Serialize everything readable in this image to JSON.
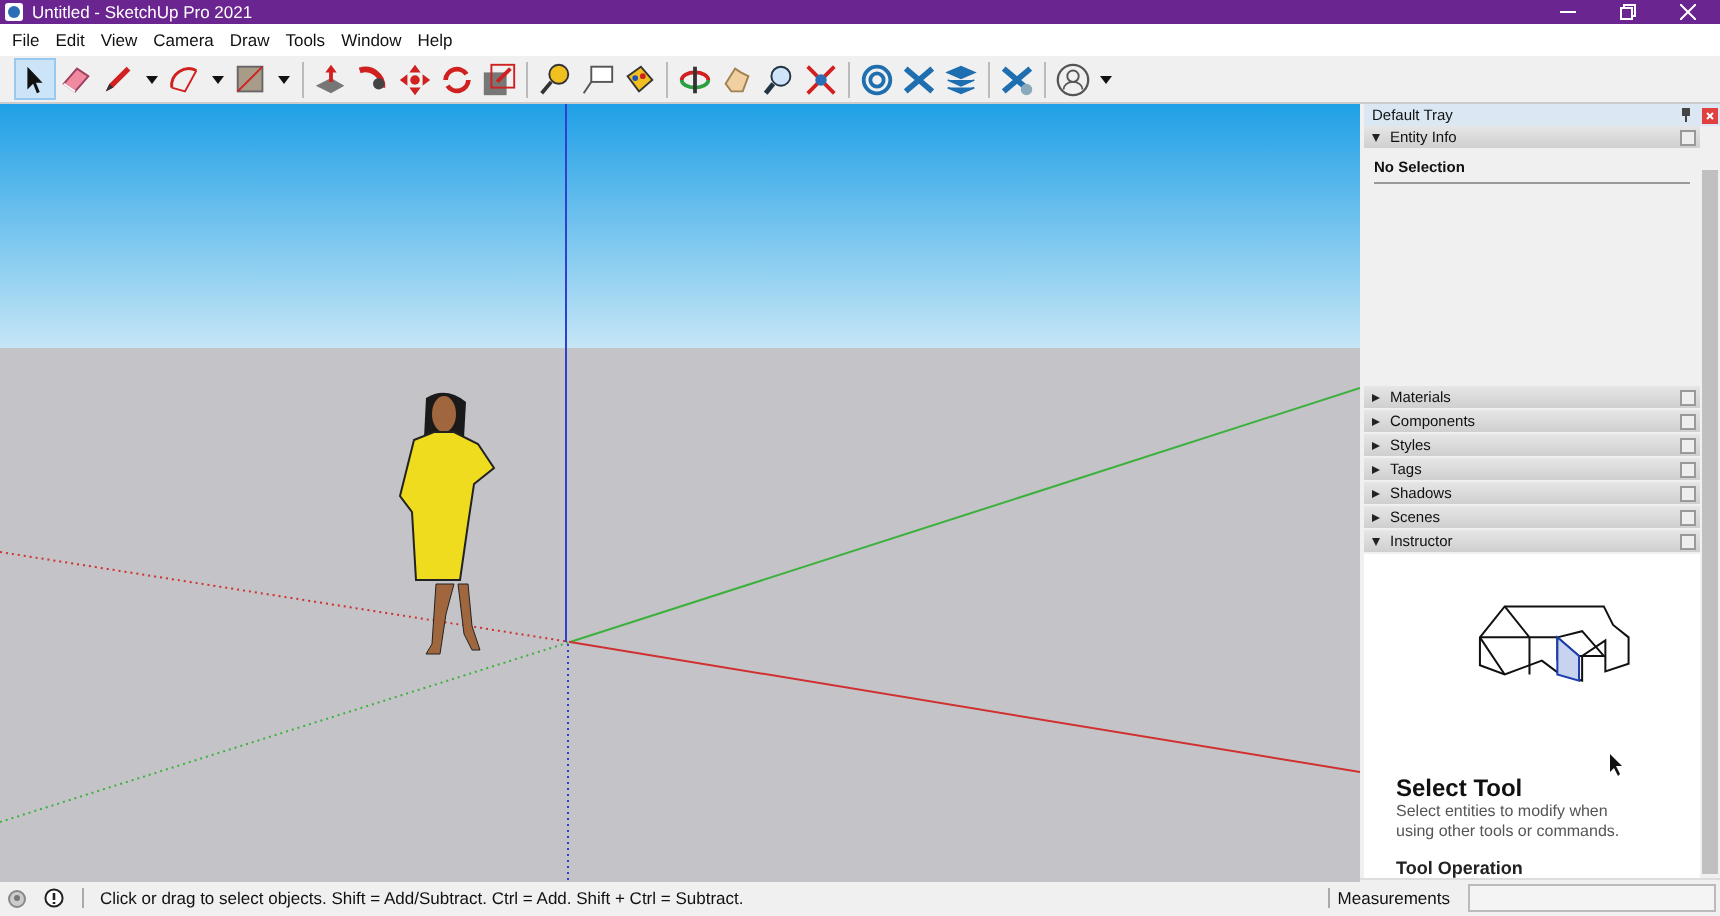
{
  "window": {
    "title": "Untitled - SketchUp Pro 2021"
  },
  "menu": [
    "File",
    "Edit",
    "View",
    "Camera",
    "Draw",
    "Tools",
    "Window",
    "Help"
  ],
  "toolbar": [
    [
      {
        "selected": true,
        "dropdown": false
      },
      {
        "selected": false,
        "dropdown": false
      },
      {
        "selected": false,
        "dropdown": true
      },
      {
        "selected": false,
        "dropdown": true
      },
      {
        "selected": false,
        "dropdown": true
      }
    ],
    [
      {
        "selected": false,
        "dropdown": false
      },
      {
        "selected": false,
        "dropdown": false
      },
      {
        "selected": false,
        "dropdown": false
      },
      {
        "selected": false,
        "dropdown": false
      },
      {
        "selected": false,
        "dropdown": false
      }
    ],
    [
      {
        "selected": false,
        "dropdown": false
      },
      {
        "selected": false,
        "dropdown": false
      },
      {
        "selected": false,
        "dropdown": false
      }
    ],
    [
      {
        "selected": false,
        "dropdown": false
      },
      {
        "selected": false,
        "dropdown": false
      },
      {
        "selected": false,
        "dropdown": false
      },
      {
        "selected": false,
        "dropdown": false
      }
    ],
    [
      {
        "selected": false,
        "dropdown": false
      },
      {
        "selected": false,
        "dropdown": false
      },
      {
        "selected": false,
        "dropdown": false
      }
    ],
    [
      {
        "selected": false,
        "dropdown": false
      }
    ],
    [
      {
        "selected": false,
        "dropdown": true
      }
    ]
  ],
  "tray": {
    "title": "Default Tray",
    "entity_info": {
      "label": "Entity Info",
      "expanded": true,
      "selection": "No Selection"
    },
    "panels": [
      {
        "label": "Materials",
        "expanded": false
      },
      {
        "label": "Components",
        "expanded": false
      },
      {
        "label": "Styles",
        "expanded": false
      },
      {
        "label": "Tags",
        "expanded": false
      },
      {
        "label": "Shadows",
        "expanded": false
      },
      {
        "label": "Scenes",
        "expanded": false
      },
      {
        "label": "Instructor",
        "expanded": true
      }
    ],
    "instructor": {
      "title": "Select Tool",
      "description": "Select entities to modify when using other tools or commands.",
      "section": "Tool Operation"
    }
  },
  "status_bar": {
    "hint": "Click or drag to select objects. Shift = Add/Subtract. Ctrl = Add. Shift + Ctrl = Subtract.",
    "measurements_label": "Measurements"
  }
}
